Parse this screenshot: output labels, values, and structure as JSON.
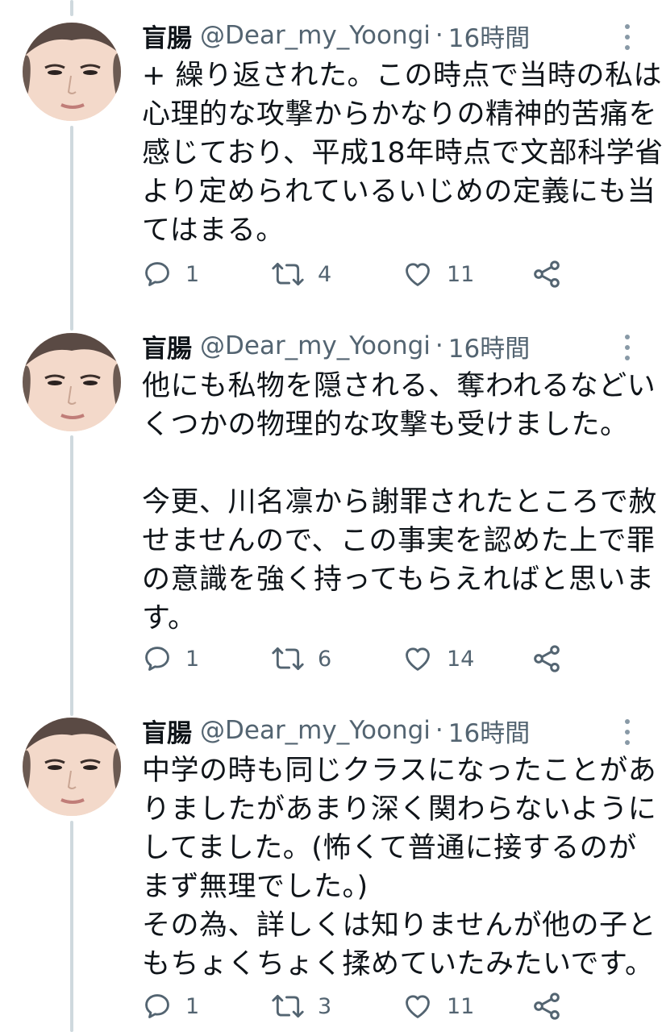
{
  "tweets": [
    {
      "name": "盲腸",
      "handle": "@Dear_my_Yoongi",
      "separator": "·",
      "time": "16時間",
      "lines": [
        "+ 繰り返された。この時点で当時の私は",
        "心理的な攻撃からかなりの精神的苦痛を",
        "感じており、平成18年時点で文部科学省",
        "より定められているいじめの定義にも当",
        "てはまる。"
      ],
      "replies": "1",
      "retweets": "4",
      "likes": "11"
    },
    {
      "name": "盲腸",
      "handle": "@Dear_my_Yoongi",
      "separator": "·",
      "time": "16時間",
      "lines": [
        "他にも私物を隠される、奪われるなどい",
        "くつかの物理的な攻撃も受けました。",
        "",
        "今更、川名凛から謝罪されたところで赦",
        "せませんので、この事実を認めた上で罪",
        "の意識を強く持ってもらえればと思いま",
        "す。"
      ],
      "replies": "1",
      "retweets": "6",
      "likes": "14"
    },
    {
      "name": "盲腸",
      "handle": "@Dear_my_Yoongi",
      "separator": "·",
      "time": "16時間",
      "lines": [
        "中学の時も同じクラスになったことがあ",
        "りましたがあまり深く関わらないように",
        "してました。(怖くて普通に接するのが",
        "まず無理でした。)",
        "その為、詳しくは知りませんが他の子と",
        "もちょくちょく揉めていたみたいです。"
      ],
      "replies": "1",
      "retweets": "3",
      "likes": "11"
    }
  ],
  "icons": {
    "reply": "reply-icon",
    "retweet": "retweet-icon",
    "like": "heart-icon",
    "share": "share-icon",
    "more": "more-icon"
  },
  "colors": {
    "text": "#0f1419",
    "secondary": "#536471",
    "thread_line": "#cfd9de"
  }
}
